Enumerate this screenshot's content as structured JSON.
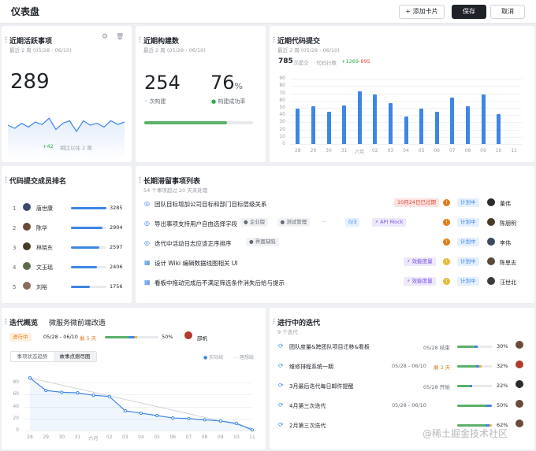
{
  "header": {
    "title": "仪表盘",
    "add_card": "+ 添加卡片",
    "save": "保存",
    "cancel": "取消"
  },
  "recent": {
    "title": "近期活跃事项",
    "subtitle": "最近 2 周 (05/28 - 06/10)",
    "value": "289",
    "delta": "+42",
    "delta_text": "相比以往 2 周",
    "spark": [
      55,
      50,
      58,
      52,
      60,
      56,
      66,
      48,
      58,
      62,
      45,
      62,
      55,
      58,
      52,
      62,
      56,
      60
    ]
  },
  "build": {
    "title": "近期构建数",
    "subtitle": "最近 2 周 (05/28 - 06/10)",
    "count": "254",
    "count_label": "次构建",
    "rate": "76",
    "rate_unit": "%",
    "rate_label": "构建成功率",
    "progress": 0.76
  },
  "commits": {
    "title": "近期代码提交",
    "subtitle": "最近 2 周 (05/28 - 06/10)",
    "count": "785",
    "count_label": "次提交",
    "lines_label": "代码行数",
    "added": "+1269",
    "removed": "-895",
    "chart_data": {
      "type": "bar",
      "categories": [
        "28",
        "29",
        "30",
        "31",
        "六月",
        "02",
        "03",
        "04",
        "05",
        "06",
        "07",
        "08",
        "09",
        "10",
        "11"
      ],
      "values": [
        49,
        52,
        45,
        53,
        73,
        69,
        57,
        38,
        49,
        45,
        64,
        52,
        68,
        41,
        0
      ],
      "ylim": [
        0,
        100
      ],
      "yticks": [
        "0",
        "10",
        "20",
        "30",
        "40",
        "50",
        "60",
        "70",
        "80",
        "90"
      ]
    }
  },
  "ranking": {
    "title": "代码提交成员排名",
    "items": [
      {
        "rank": "1",
        "name": "唐世康",
        "value": "3285",
        "pct": 1.0
      },
      {
        "rank": "2",
        "name": "陈华",
        "value": "2904",
        "pct": 0.88
      },
      {
        "rank": "3",
        "name": "林晓东",
        "value": "2597",
        "pct": 0.79
      },
      {
        "rank": "4",
        "name": "文玉瑶",
        "value": "2406",
        "pct": 0.73
      },
      {
        "rank": "5",
        "name": "刘裕",
        "value": "1756",
        "pct": 0.53
      }
    ]
  },
  "stale": {
    "title": "长期滞留事项列表",
    "subtitle": "54 个事项超过 20 天未处理",
    "items": [
      {
        "text": "团队目标增加公司目标和部门目标层级关系",
        "tags": [
          {
            "label": "10月24日已过期",
            "kind": "red"
          }
        ],
        "status": "计划中",
        "owner": "董伟"
      },
      {
        "text": "导出事项支持用户自由选择字段",
        "tags": [
          {
            "label": "● 企业版",
            "kind": "gray"
          },
          {
            "label": "● 测试管理",
            "kind": "gray"
          },
          {
            "label": "···",
            "kind": "plain"
          },
          {
            "label": "0/3",
            "kind": "blue"
          },
          {
            "label": "⚡ API Mock",
            "kind": "purple"
          }
        ],
        "status": "计划中",
        "owner": "陈朋明"
      },
      {
        "text": "迭代中活动日志应该正序排序",
        "tags": [
          {
            "label": "● 界面缺陷",
            "kind": "gray"
          }
        ],
        "status": "计划中",
        "owner": "李伟"
      },
      {
        "text": "设计 Wiki 编辑数据线图相关 UI",
        "tags": [
          {
            "label": "⚡ 效能度量",
            "kind": "purple"
          }
        ],
        "status": "计划中",
        "owner": "陈思志"
      },
      {
        "text": "看板中拖动完成后不满足筛选条件消失后给与提示",
        "tags": [
          {
            "label": "⚡ 效能度量",
            "kind": "purple"
          }
        ],
        "status": "计划中",
        "owner": "汪世北"
      }
    ]
  },
  "overview": {
    "title": "迭代概览",
    "project": "微服务微前端改造",
    "state": "进行中",
    "range": "05/28 - 06/10",
    "remain": "剩 5 天",
    "pct": "50%",
    "owner": "邵帆",
    "tab1": "事项状态趋势",
    "tab2": "故事点燃尽图",
    "legend_actual": "实际线",
    "legend_ideal": "理想线",
    "chart_data": {
      "type": "line",
      "x": [
        "28",
        "29",
        "30",
        "31",
        "六月",
        "02",
        "03",
        "04",
        "05",
        "06",
        "07",
        "08",
        "09",
        "10",
        "11"
      ],
      "series": [
        {
          "name": "实际线",
          "values": [
            88,
            67,
            64,
            63,
            59,
            57,
            33,
            29,
            25,
            21,
            20,
            18,
            16,
            12,
            1
          ]
        },
        {
          "name": "理想线",
          "values": [
            88,
            82,
            76,
            70,
            64,
            58,
            52,
            46,
            40,
            34,
            28,
            22,
            16,
            10,
            4
          ]
        }
      ],
      "ylim": [
        0,
        100
      ],
      "yticks": [
        "0",
        "20",
        "40",
        "60",
        "80"
      ]
    }
  },
  "iterations": {
    "title": "进行中的迭代",
    "subtitle": "9 个迭代",
    "items": [
      {
        "name": "团队度量&跨团队项目迁移&看板",
        "date": "05/28 结束",
        "remain": "",
        "pct": "30%"
      },
      {
        "name": "维修排程系统一期",
        "date": "05/28 - 06/10",
        "remain": "剩 2 天",
        "pct": "32%"
      },
      {
        "name": "3月最后迭代每日邮件提醒",
        "date": "05/28 开始",
        "remain": "",
        "pct": "22%"
      },
      {
        "name": "4月第三次迭代",
        "date": "05/28 - 06/10",
        "remain": "",
        "pct": "50%"
      },
      {
        "name": "2月第三次迭代",
        "date": "",
        "remain": "",
        "pct": "62%"
      }
    ]
  },
  "watermark": "@稀土掘金技术社区"
}
